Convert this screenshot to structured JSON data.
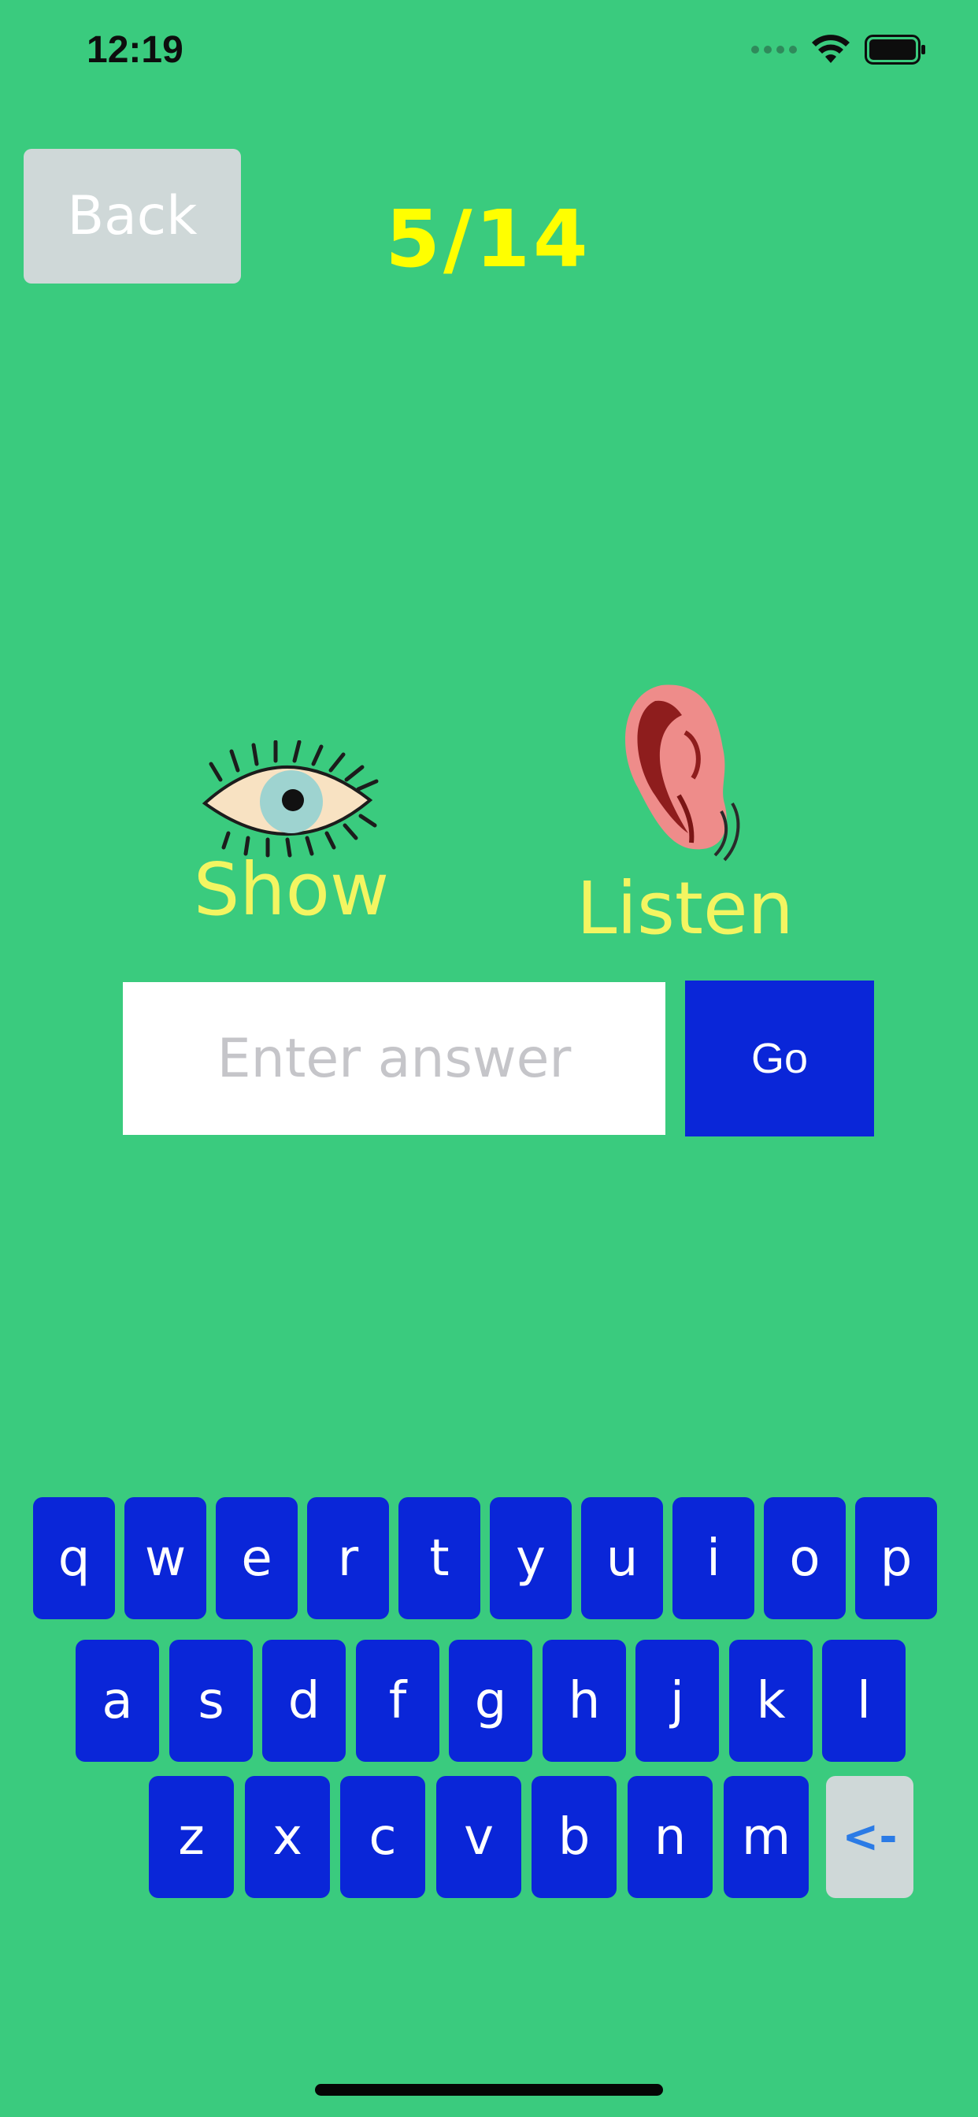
{
  "status_bar": {
    "time": "12:19"
  },
  "header": {
    "back_label": "Back",
    "progress": "5/14"
  },
  "options": {
    "show_label": "Show",
    "listen_label": "Listen",
    "show_icon": "eye-icon",
    "listen_icon": "ear-icon"
  },
  "answer": {
    "placeholder": "Enter answer",
    "value": "",
    "go_label": "Go"
  },
  "keyboard": {
    "rows": [
      [
        "q",
        "w",
        "e",
        "r",
        "t",
        "y",
        "u",
        "i",
        "o",
        "p"
      ],
      [
        "a",
        "s",
        "d",
        "f",
        "g",
        "h",
        "j",
        "k",
        "l"
      ],
      [
        "z",
        "x",
        "c",
        "v",
        "b",
        "n",
        "m"
      ]
    ],
    "backspace_label": "<-"
  },
  "colors": {
    "background": "#3acb7e",
    "key": "#0a26d8",
    "accent_text": "#ffff00",
    "option_text": "#f3f561"
  }
}
